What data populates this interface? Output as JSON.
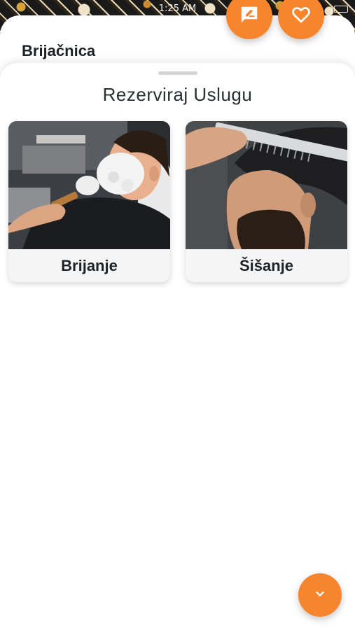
{
  "status_bar": {
    "time": "1:25 AM"
  },
  "header": {
    "shop_name": "Brijačnica"
  },
  "actions": {
    "review_icon": "rate-review-icon",
    "favorite_icon": "heart-outline-icon",
    "expand_icon": "chevron-down-icon"
  },
  "sheet": {
    "title": "Rezerviraj Uslugu",
    "services": [
      {
        "label": "Brijanje",
        "photo": "man-shaving-photo"
      },
      {
        "label": "Šišanje",
        "photo": "haircut-comb-photo"
      }
    ]
  },
  "colors": {
    "accent": "#f7852d",
    "text": "#1d2327",
    "card_bg": "#f5f5f5"
  }
}
